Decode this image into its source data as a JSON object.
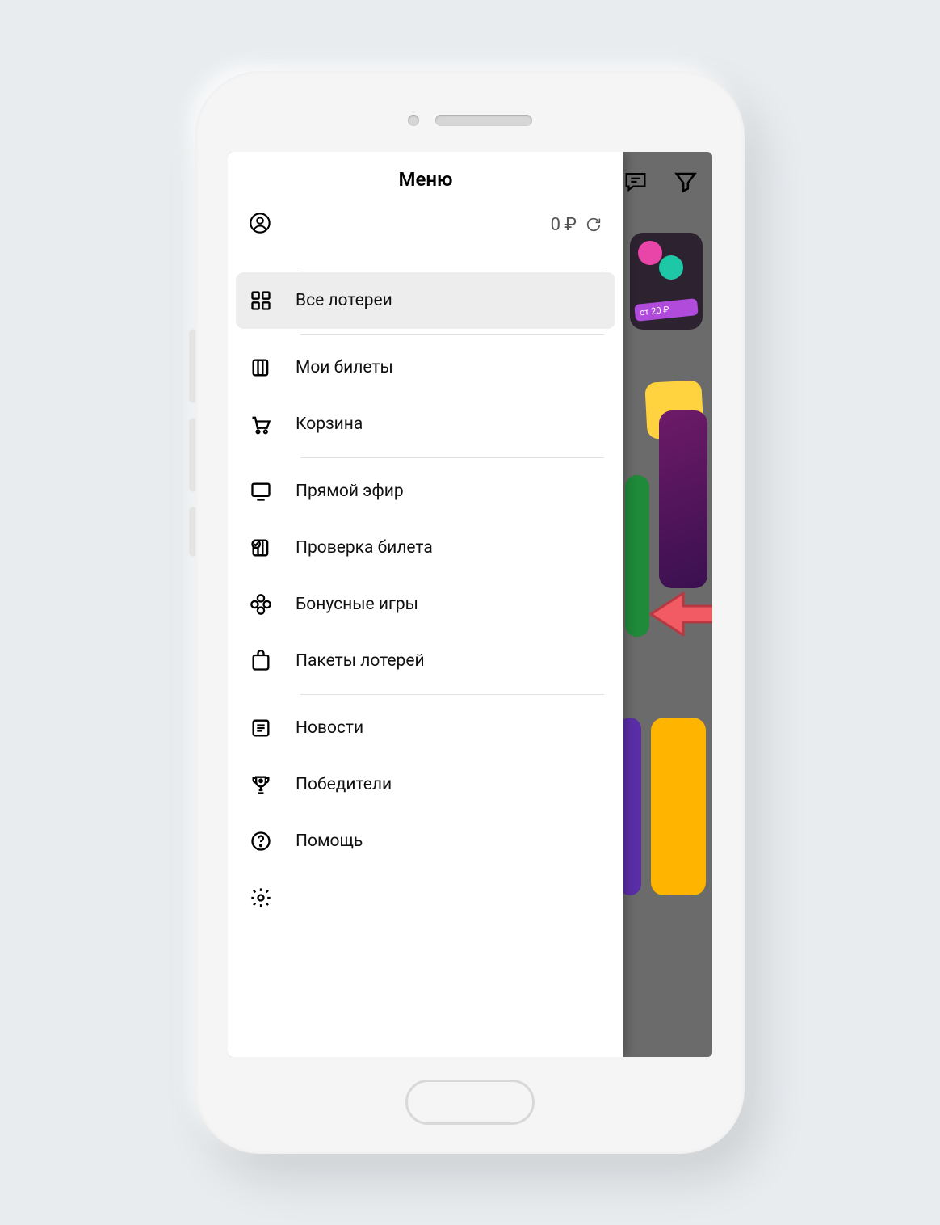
{
  "drawer": {
    "title": "Меню",
    "balance": "0 ₽"
  },
  "menu": {
    "all_lotteries": "Все лотереи",
    "my_tickets": "Мои билеты",
    "cart": "Корзина",
    "live": "Прямой эфир",
    "check_ticket": "Проверка билета",
    "bonus_games": "Бонусные игры",
    "lottery_packs": "Пакеты лотерей",
    "news": "Новости",
    "winners": "Победители",
    "help": "Помощь"
  },
  "background": {
    "price_label": "от 20 ₽"
  }
}
